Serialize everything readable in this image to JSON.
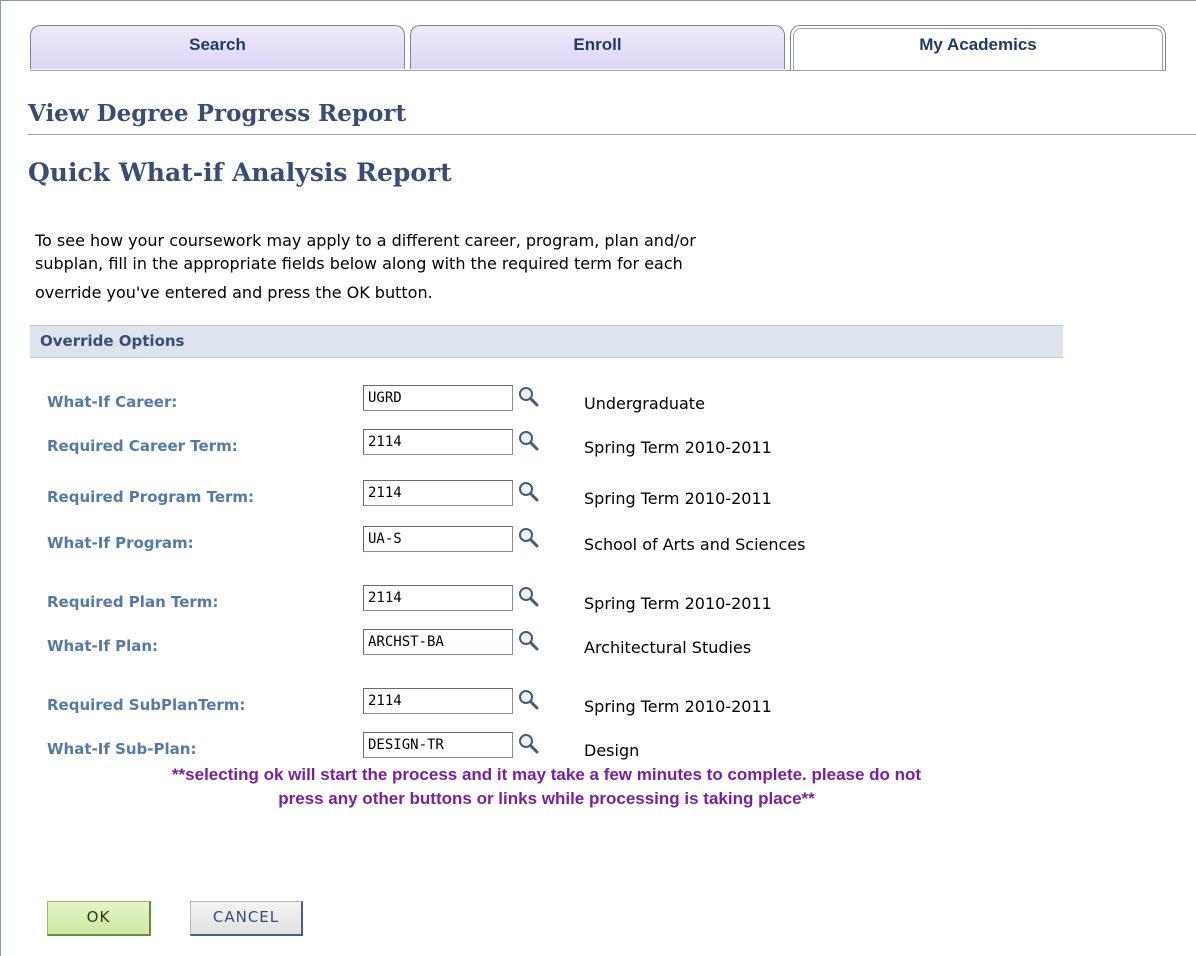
{
  "tabs": [
    {
      "label": "Search"
    },
    {
      "label": "Enroll"
    },
    {
      "label": "My Academics"
    }
  ],
  "page_title": "View Degree Progress Report",
  "sub_title": "Quick What-if Analysis Report",
  "instructions": {
    "line1": "To see how your coursework may apply to a different career, program, plan and/or",
    "line2": "subplan, fill in the appropriate fields below along with the required term for each",
    "line3": "override you've entered and press the OK button."
  },
  "section_header": "Override Options",
  "fields": [
    {
      "label": "What-If Career:",
      "value": "UGRD",
      "description": "Undergraduate"
    },
    {
      "label": "Required Career Term:",
      "value": "2114",
      "description": "Spring Term 2010-2011"
    },
    {
      "label": "Required Program Term:",
      "value": "2114",
      "description": "Spring Term 2010-2011"
    },
    {
      "label": "What-If Program:",
      "value": "UA-S",
      "description": "School of Arts and Sciences"
    },
    {
      "label": "Required Plan Term:",
      "value": "2114",
      "description": "Spring Term 2010-2011"
    },
    {
      "label": "What-If Plan:",
      "value": "ARCHST-BA",
      "description": "Architectural Studies"
    },
    {
      "label": "Required SubPlanTerm:",
      "value": "2114",
      "description": "Spring Term 2010-2011"
    },
    {
      "label": "What-If Sub-Plan:",
      "value": "DESIGN-TR",
      "description": "Design"
    }
  ],
  "notice": {
    "line1": "**selecting ok will start the process and it may take a few minutes to complete. please do not",
    "line2": "press any other buttons or links while processing is taking place**"
  },
  "buttons": {
    "ok": "OK",
    "cancel": "CANCEL"
  },
  "icons": {
    "lookup": "magnifier-icon"
  },
  "colors": {
    "heading": "#3a4b75",
    "label": "#5579a8",
    "notice": "#7a1fa0",
    "section_bg": "#dde4ee"
  }
}
